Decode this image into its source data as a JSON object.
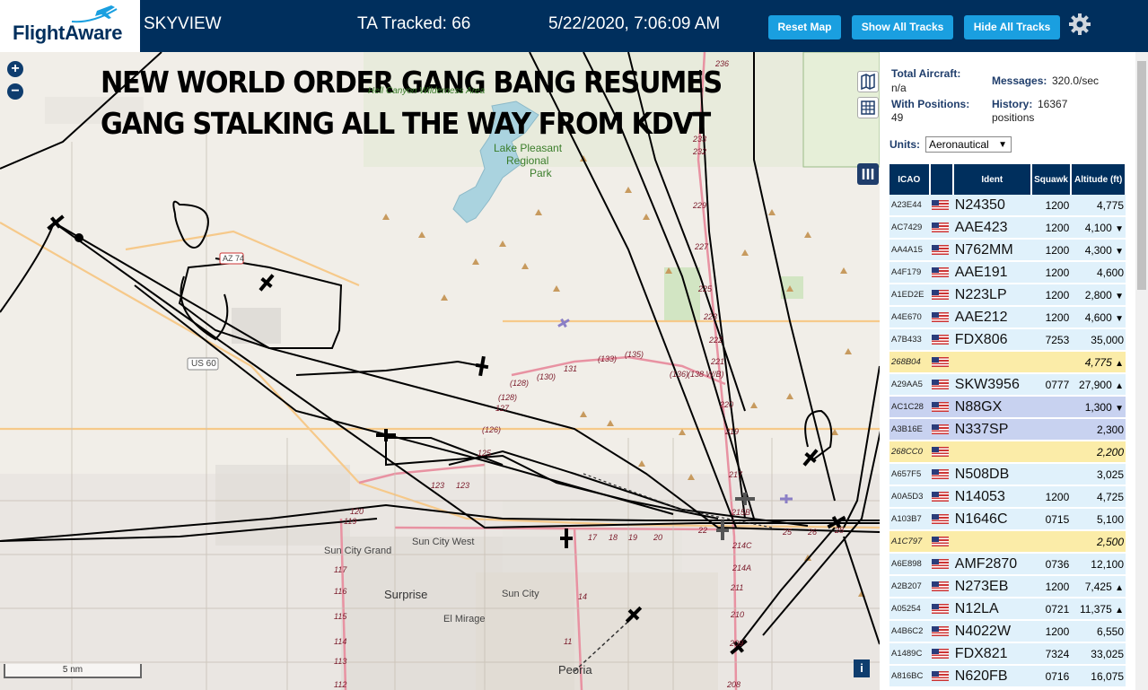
{
  "header": {
    "brand": "FlightAware",
    "app_name": "SKYVIEW",
    "tracked": "TA Tracked: 66",
    "datetime": "5/22/2020, 7:06:09 AM",
    "reset_label": "Reset Map",
    "show_label": "Show All Tracks",
    "hide_label": "Hide All Tracks",
    "settings_icon": "gear-icon"
  },
  "map": {
    "zoom_in": "+",
    "zoom_out": "−",
    "overlay_line1": "NEW WORLD ORDER GANG BANG RESUMES",
    "overlay_line2": "GANG STALKING ALL THE WAY FROM KDVT",
    "scale_label": "5 nm",
    "info_label": "i",
    "labels": {
      "wilderness": "Hell Canyon Wilderness Area",
      "lake1": "Lake Pleasant",
      "lake2": "Regional",
      "lake3": "Park",
      "us60": "US 60",
      "sun_city_grand": "Sun City Grand",
      "sun_city_west": "Sun City West",
      "surprise": "Surprise",
      "sun_city": "Sun City",
      "el_mirage": "El Mirage",
      "peoria": "Peoria",
      "a74": "AZ 74"
    }
  },
  "stats": {
    "total_label": "Total Aircraft:",
    "total_value": "n/a",
    "messages_label": "Messages:",
    "messages_value": "320.0/sec",
    "positions_label": "With Positions:",
    "positions_value": "49",
    "history_label": "History:",
    "history_value": "16367",
    "history_unit": "positions",
    "units_label": "Units:",
    "units_value": "Aeronautical"
  },
  "table": {
    "headers": [
      "ICAO",
      "",
      "Ident",
      "Squawk",
      "Altitude (ft)"
    ],
    "rows": [
      {
        "icao": "A23E44",
        "ident": "N24350",
        "squawk": "1200",
        "alt": "4,775",
        "trend": "",
        "style": "row"
      },
      {
        "icao": "AC7429",
        "ident": "AAE423",
        "squawk": "1200",
        "alt": "4,100",
        "trend": "▼",
        "style": "row"
      },
      {
        "icao": "AA4A15",
        "ident": "N762MM",
        "squawk": "1200",
        "alt": "4,300",
        "trend": "▼",
        "style": "row"
      },
      {
        "icao": "A4F179",
        "ident": "AAE191",
        "squawk": "1200",
        "alt": "4,600",
        "trend": "",
        "style": "row"
      },
      {
        "icao": "A1ED2E",
        "ident": "N223LP",
        "squawk": "1200",
        "alt": "2,800",
        "trend": "▼",
        "style": "row"
      },
      {
        "icao": "A4E670",
        "ident": "AAE212",
        "squawk": "1200",
        "alt": "4,600",
        "trend": "▼",
        "style": "row"
      },
      {
        "icao": "A7B433",
        "ident": "FDX806",
        "squawk": "7253",
        "alt": "35,000",
        "trend": "",
        "style": "row"
      },
      {
        "icao": "268B04",
        "ident": "",
        "squawk": "",
        "alt": "4,775",
        "trend": "▲",
        "style": "row yellow"
      },
      {
        "icao": "A29AA5",
        "ident": "SKW3956",
        "squawk": "0777",
        "alt": "27,900",
        "trend": "▲",
        "style": "row"
      },
      {
        "icao": "AC1C28",
        "ident": "N88GX",
        "squawk": "",
        "alt": "1,300",
        "trend": "▼",
        "style": "row sel"
      },
      {
        "icao": "A3B16E",
        "ident": "N337SP",
        "squawk": "",
        "alt": "2,300",
        "trend": "",
        "style": "row sel"
      },
      {
        "icao": "268CC0",
        "ident": "",
        "squawk": "",
        "alt": "2,200",
        "trend": "",
        "style": "row yellow"
      },
      {
        "icao": "A657F5",
        "ident": "N508DB",
        "squawk": "",
        "alt": "3,025",
        "trend": "",
        "style": "row"
      },
      {
        "icao": "A0A5D3",
        "ident": "N14053",
        "squawk": "1200",
        "alt": "4,725",
        "trend": "",
        "style": "row"
      },
      {
        "icao": "A103B7",
        "ident": "N1646C",
        "squawk": "0715",
        "alt": "5,100",
        "trend": "",
        "style": "row"
      },
      {
        "icao": "A1C797",
        "ident": "",
        "squawk": "",
        "alt": "2,500",
        "trend": "",
        "style": "row yellow"
      },
      {
        "icao": "A6E898",
        "ident": "AMF2870",
        "squawk": "0736",
        "alt": "12,100",
        "trend": "",
        "style": "row"
      },
      {
        "icao": "A2B207",
        "ident": "N273EB",
        "squawk": "1200",
        "alt": "7,425",
        "trend": "▲",
        "style": "row"
      },
      {
        "icao": "A05254",
        "ident": "N12LA",
        "squawk": "0721",
        "alt": "11,375",
        "trend": "▲",
        "style": "row"
      },
      {
        "icao": "A4B6C2",
        "ident": "N4022W",
        "squawk": "1200",
        "alt": "6,550",
        "trend": "",
        "style": "row"
      },
      {
        "icao": "A1489C",
        "ident": "FDX821",
        "squawk": "7324",
        "alt": "33,025",
        "trend": "",
        "style": "row"
      },
      {
        "icao": "A816BC",
        "ident": "N620FB",
        "squawk": "0716",
        "alt": "16,075",
        "trend": "",
        "style": "row"
      }
    ]
  }
}
